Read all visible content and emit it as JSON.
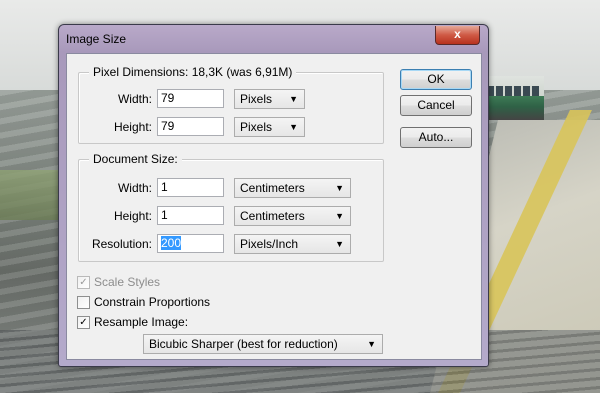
{
  "window": {
    "title": "Image Size",
    "close_label": "x"
  },
  "pixel_dimensions": {
    "legend": "Pixel Dimensions:  18,3K (was 6,91M)",
    "width": {
      "label": "Width:",
      "value": "79",
      "unit": "Pixels"
    },
    "height": {
      "label": "Height:",
      "value": "79",
      "unit": "Pixels"
    }
  },
  "document_size": {
    "legend": "Document Size:",
    "width": {
      "label": "Width:",
      "value": "1",
      "unit": "Centimeters"
    },
    "height": {
      "label": "Height:",
      "value": "1",
      "unit": "Centimeters"
    },
    "resolution": {
      "label": "Resolution:",
      "value": "200",
      "unit": "Pixels/Inch"
    }
  },
  "buttons": {
    "ok": "OK",
    "cancel": "Cancel",
    "auto": "Auto..."
  },
  "options": {
    "scale_styles": {
      "label": "Scale Styles",
      "checked": true,
      "enabled": false
    },
    "constrain_proportions": {
      "label": "Constrain Proportions",
      "checked": false,
      "enabled": true
    },
    "resample_image": {
      "label": "Resample Image:",
      "checked": true,
      "enabled": true
    },
    "resample_method": "Bicubic Sharper (best for reduction)"
  },
  "icons": {
    "dropdown": "chevron-down-icon",
    "check": "checkmark-icon",
    "link": "chain-link-icon"
  }
}
